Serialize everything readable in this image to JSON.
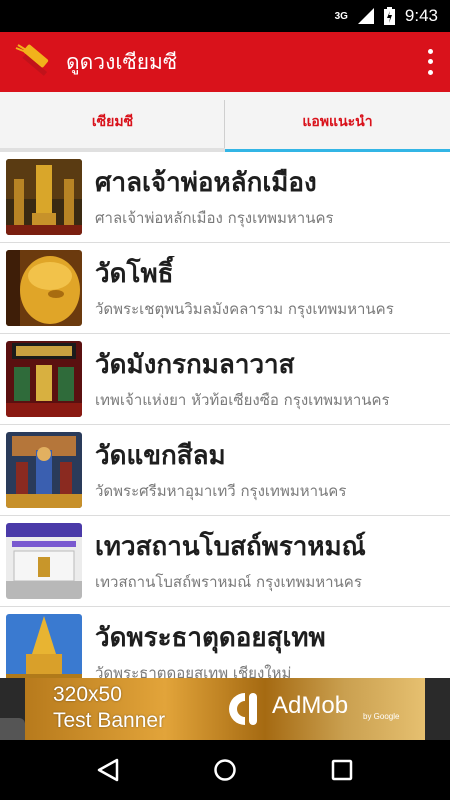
{
  "status_bar": {
    "network": "3G",
    "time": "9:43"
  },
  "app_bar": {
    "title": "ดูดวงเซียมซี",
    "icon": "fortune-sticks-icon"
  },
  "tabs": [
    {
      "label": "เซียมซี",
      "selected": true
    },
    {
      "label": "แอพแนะนำ",
      "selected": false
    }
  ],
  "list": [
    {
      "title": "ศาลเจ้าพ่อหลักเมือง",
      "subtitle": "ศาลเจ้าพ่อหลักเมือง กรุงเทพมหานคร"
    },
    {
      "title": "วัดโพธิ์",
      "subtitle": "วัดพระเชตุพนวิมลมังคลาราม กรุงเทพมหานคร"
    },
    {
      "title": "วัดมังกรกมลาวาส",
      "subtitle": "เทพเจ้าแห่งยา หัวท้อเซียงซือ กรุงเทพมหานคร"
    },
    {
      "title": "วัดแขกสีลม",
      "subtitle": "วัดพระศรีมหาอุมาเทวี กรุงเทพมหานคร"
    },
    {
      "title": "เทวสถานโบสถ์พราหมณ์",
      "subtitle": "เทวสถานโบสถ์พราหมณ์ กรุงเทพมหานคร"
    },
    {
      "title": "วัดพระธาตุดอยสุเทพ",
      "subtitle": "วัดพระธาตุดอยสุเทพ เชียงใหม่"
    }
  ],
  "ad": {
    "line1": "320x50",
    "line2": "Test Banner",
    "brand": "AdMob",
    "by": "by Google"
  },
  "colors": {
    "primary": "#d9121b",
    "tab_indicator": "#33b5e5"
  }
}
